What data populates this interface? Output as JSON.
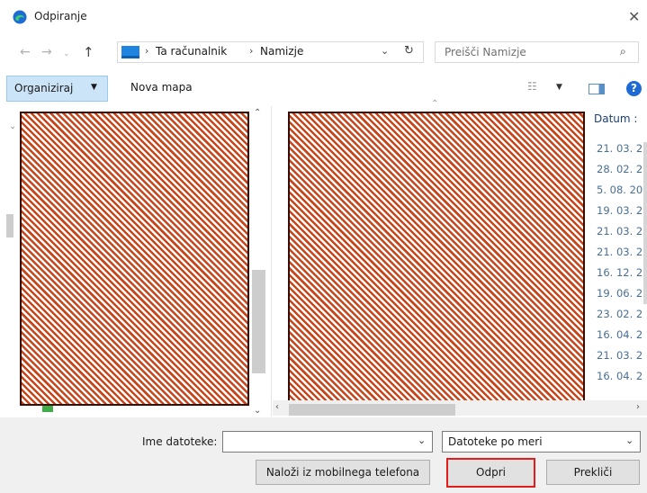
{
  "window": {
    "title": "Odpiranje",
    "accent_color": "#1e6bd6",
    "highlight_color": "#e21b1b"
  },
  "nav": {
    "back": "←",
    "forward": "→",
    "recent": "⌄",
    "up": "↑"
  },
  "address": {
    "crumbs": [
      "Ta računalnik",
      "Namizje"
    ],
    "sep": "›",
    "dropdown": "⌄",
    "refresh": "↻"
  },
  "search": {
    "placeholder": "Preišči Namizje",
    "icon": "⌕"
  },
  "toolbar": {
    "organize_label": "Organiziraj",
    "organize_caret": "▼",
    "new_folder_label": "Nova mapa",
    "view_icon": "☷",
    "view_caret": "▼",
    "help": "?"
  },
  "files": {
    "date_header": "Datum :",
    "dates": [
      "21. 03. 2",
      "28. 02. 2",
      "5. 08. 20",
      "19. 03. 2",
      "21. 03. 2",
      "21. 03. 2",
      "16. 12. 2",
      "19. 06. 2",
      "23. 02. 2",
      "16. 04. 2",
      "21. 03. 2",
      "16. 04. 2"
    ]
  },
  "scroll": {
    "up": "⌃",
    "down": "⌄",
    "left": "‹",
    "right": "›"
  },
  "bottom": {
    "filename_label": "Ime datoteke:",
    "filename_value": "",
    "filetype_label": "Datoteke po meri",
    "caret": "⌄",
    "upload_mobile_label": "Naloži iz mobilnega telefona",
    "open_label": "Odpri",
    "cancel_label": "Prekliči"
  },
  "close_icon": "✕"
}
